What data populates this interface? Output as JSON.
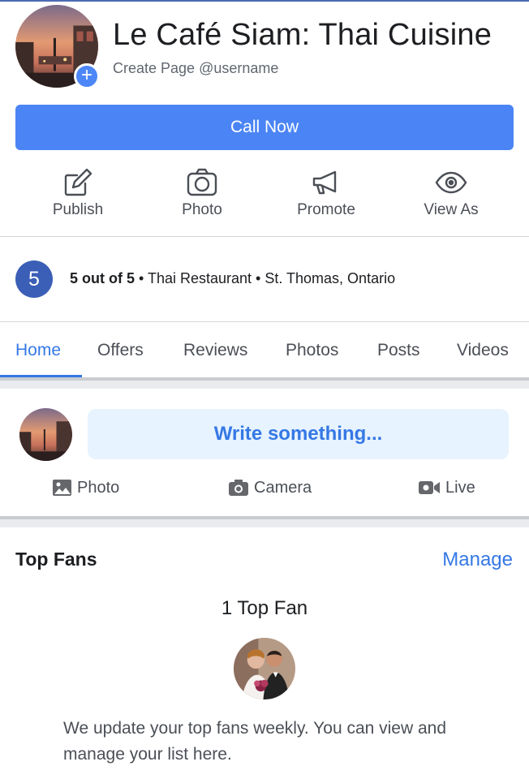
{
  "header": {
    "title": "Le Café Siam: Thai Cuisine",
    "username_prompt": "Create Page @username",
    "add_photo_symbol": "+"
  },
  "primary_action": {
    "label": "Call Now",
    "color": "#4b85f5"
  },
  "actions": [
    {
      "label": "Publish",
      "icon": "edit-icon"
    },
    {
      "label": "Photo",
      "icon": "camera-icon"
    },
    {
      "label": "Promote",
      "icon": "megaphone-icon"
    },
    {
      "label": "View As",
      "icon": "eye-icon"
    }
  ],
  "rating": {
    "badge": "5",
    "score_text": "5 out of 5",
    "details": " • Thai Restaurant • St. Thomas, Ontario"
  },
  "tabs": [
    {
      "label": "Home",
      "active": true
    },
    {
      "label": "Offers"
    },
    {
      "label": "Reviews"
    },
    {
      "label": "Photos"
    },
    {
      "label": "Posts"
    },
    {
      "label": "Videos"
    }
  ],
  "composer": {
    "prompt": "Write something...",
    "actions": [
      {
        "label": "Photo",
        "icon": "image-icon"
      },
      {
        "label": "Camera",
        "icon": "camera-icon"
      },
      {
        "label": "Live",
        "icon": "video-icon"
      }
    ]
  },
  "top_fans": {
    "title": "Top Fans",
    "manage_label": "Manage",
    "count_text": "1 Top Fan",
    "description": "We update your top fans weekly. You can view and manage your list here."
  },
  "colors": {
    "accent": "#3578e5",
    "rating_badge": "#3b5fb6"
  }
}
